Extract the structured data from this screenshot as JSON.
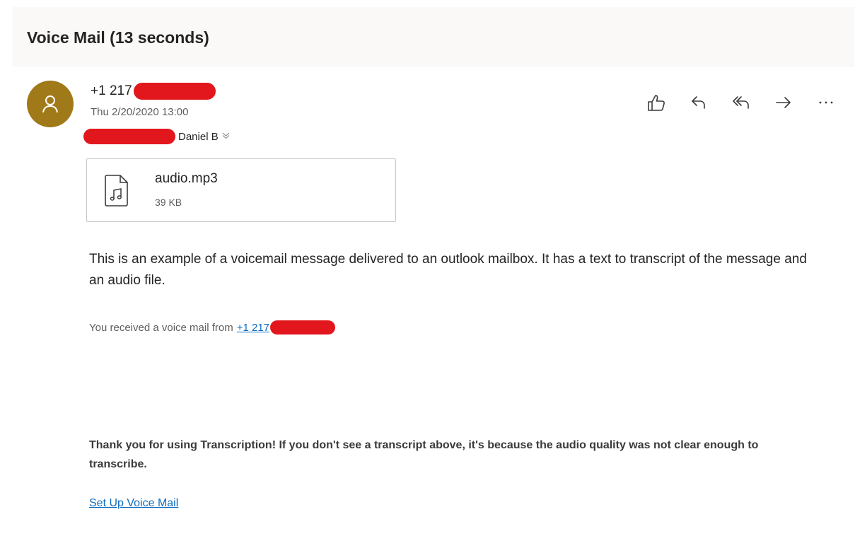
{
  "header": {
    "subject": "Voice Mail (13 seconds)"
  },
  "message": {
    "avatar_icon": "person-icon",
    "avatar_color": "#a07a18",
    "sender_visible": "+1 217",
    "date": "Thu 2/20/2020 13:00",
    "recipient_visible": "Daniel B",
    "expand_icon": "chevron-down-icon",
    "redaction_color": "#e2171d"
  },
  "actions": [
    {
      "name": "like",
      "icon": "thumbs-up-icon"
    },
    {
      "name": "reply",
      "icon": "reply-icon"
    },
    {
      "name": "reply-all",
      "icon": "reply-all-icon"
    },
    {
      "name": "forward",
      "icon": "forward-icon"
    },
    {
      "name": "more",
      "icon": "more-icon"
    }
  ],
  "attachment": {
    "icon": "audio-file-icon",
    "name": "audio.mp3",
    "size": "39 KB"
  },
  "body": {
    "intro": "This is an example of a voicemail message delivered to an outlook mailbox. It has a text to transcript of the message and an audio file.",
    "received_prefix": "You received a voice mail from",
    "received_link": "+1 217",
    "thanks": "Thank you for using Transcription! If you don't see a transcript above, it's because the audio quality was not clear enough to transcribe.",
    "setup_link": "Set Up Voice Mail"
  },
  "colors": {
    "link": "#0f6cbd",
    "header_bg": "#faf9f8"
  }
}
